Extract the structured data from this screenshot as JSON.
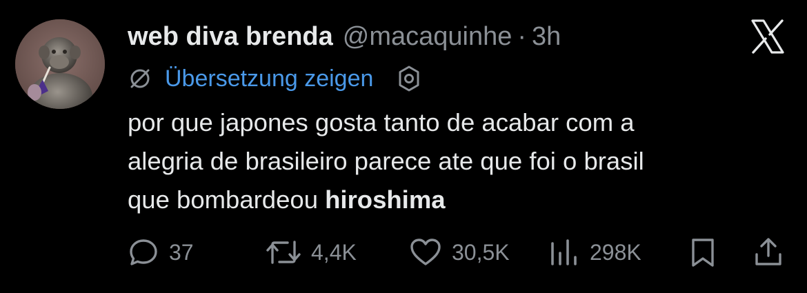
{
  "tweet": {
    "display_name": "web diva brenda",
    "handle": "@macaquinhe",
    "separator": "·",
    "time": "3h",
    "translate_label": "Übersetzung zeigen",
    "text_lines": [
      "por que japones gosta tanto de acabar com a",
      "alegria de brasileiro parece ate que foi o brasil",
      "que bombardeou "
    ],
    "text_bold": "hiroshima"
  },
  "actions": {
    "replies": "37",
    "reposts": "4,4K",
    "likes": "30,5K",
    "views": "298K"
  },
  "icons": {
    "platform": "x-logo-icon",
    "translate": "translate-icon",
    "settings": "gear-icon",
    "reply": "reply-icon",
    "repost": "repost-icon",
    "like": "heart-icon",
    "views": "views-icon",
    "bookmark": "bookmark-icon",
    "share": "share-icon"
  },
  "colors": {
    "background": "#000000",
    "text": "#e7e9ea",
    "muted": "#8b9096",
    "link": "#4a99e9"
  }
}
